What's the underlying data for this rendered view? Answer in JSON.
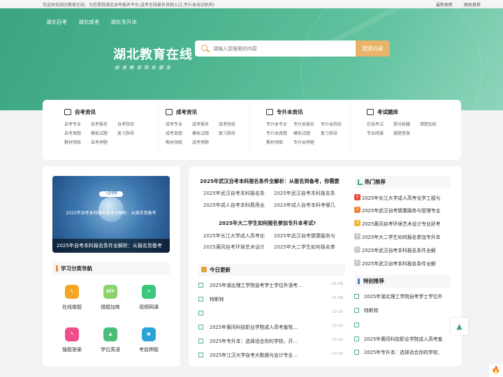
{
  "topbar": {
    "welcome": "欢迎来到湖北教育在线，为您提供湖北自考报名平台,成考在线报名官网入口,专升本培训机构!",
    "links": [
      "最新更新",
      "随机推荐"
    ]
  },
  "nav": [
    "湖北自考",
    "湖北成考",
    "湖北专升本"
  ],
  "brand": {
    "title": "湖北教育在线",
    "subtitle": "继续教育院校服务"
  },
  "search": {
    "placeholder": "请输入您搜索的内容",
    "button": "搜索内容"
  },
  "categories": [
    {
      "title": "自考资讯",
      "links": [
        "自考专业",
        "自考报名",
        "自考院校",
        "自考真题",
        "模拟试题",
        "复习指导",
        "教材领取",
        "自考押题"
      ]
    },
    {
      "title": "成考资讯",
      "links": [
        "成考专业",
        "成考报名",
        "成考院校",
        "成考真题",
        "模拟试题",
        "复习指导",
        "教材领取",
        "成考押题"
      ]
    },
    {
      "title": "专升本资讯",
      "links": [
        "专升本专业",
        "专升本报名",
        "专升本院校",
        "专升本真题",
        "模拟试题",
        "复习指导",
        "教材领取",
        "专升本押题"
      ]
    },
    {
      "title": "考试题库",
      "links": [
        "在线考试",
        "提分秘籍",
        "错题加练",
        "专业网课",
        "搜题答案"
      ]
    }
  ],
  "banner": {
    "overlay": "2025年自考本科报名条件全解析：从报名到备考",
    "pill": "+自考网",
    "caption": "2025年自考本科报名条件全解析：从报名到备考"
  },
  "study_nav": {
    "title": "学习分类导航",
    "tools": [
      {
        "label": "在线做题",
        "icon": "pencil-icon",
        "glyph": "✎",
        "color": "#f5a623"
      },
      {
        "label": "错题加练",
        "icon": "diy-icon",
        "glyph": "DIY",
        "color": "#8bd36a"
      },
      {
        "label": "视频网课",
        "icon": "video-icon",
        "glyph": "☀",
        "color": "#3cc77e"
      },
      {
        "label": "搜题答案",
        "icon": "search-answer-icon",
        "glyph": "✎",
        "color": "#ee4d8b"
      },
      {
        "label": "学位英语",
        "icon": "cap-icon",
        "glyph": "▲",
        "color": "#4bbf7a"
      },
      {
        "label": "考前押题",
        "icon": "briefcase-icon",
        "glyph": "▣",
        "color": "#2ba3d8"
      }
    ]
  },
  "middle": {
    "headline1": "2025年武汉自考本科报名条件全解析：从报名到备考，你需要",
    "links1": [
      "2025年武汉自考本科报名条",
      "2025年武汉自考本科报名条",
      "2025年成人自考本科费用全",
      "2023年成人自考本科考哪几"
    ],
    "headline2": "2025年大二学生如何报名参加专升本考试?",
    "links2": [
      "2025年长江大学成人高考化",
      "2025年武汉自考健康服务与",
      "2025黄冈自考环境艺术设计",
      "2025年大二学生如何报名参"
    ],
    "today_title": "今日更新",
    "news": [
      {
        "title": "2025年湖北理工学院自考学士学位外语考...",
        "date": "01-08"
      },
      {
        "title": "特斯特",
        "date": "01-08"
      },
      {
        "title": "",
        "date": "12-16"
      },
      {
        "title": "2025年黄冈科技职业学院成人高考畜牧...",
        "date": "12-16"
      },
      {
        "title": "2025年专升本：选择适合你的学校，开...",
        "date": "12-16"
      },
      {
        "title": "2025年江汉大学自考大数据与会计专业...",
        "date": "12-16"
      }
    ]
  },
  "hot": {
    "title": "热门推荐",
    "items": [
      {
        "num": "1",
        "color": "#e84c3d",
        "title": "2025年长江大学成人高考化学工程与"
      },
      {
        "num": "2",
        "color": "#f0813a",
        "title": "2025年武汉自考健康服务与管理专业"
      },
      {
        "num": "3",
        "color": "#f3b53b",
        "title": "2025黄冈自考环境艺术设计专业好考"
      },
      {
        "num": "4",
        "color": "#c8c8c8",
        "title": "2025年大二学生如何报名参加专升本"
      },
      {
        "num": "5",
        "color": "#c8c8c8",
        "title": "2025年武汉自考本科报名条件全解"
      },
      {
        "num": "6",
        "color": "#c8c8c8",
        "title": "2025年武汉自考本科报名条件全解"
      }
    ]
  },
  "recommend": {
    "title": "特别推荐",
    "items": [
      "2025年湖北理工学院自考学士学位外",
      "特斯特",
      "",
      "2025年黄冈科技职业学院成人高考畜",
      "2025年专升本：选择适合你的学校,"
    ]
  },
  "colors": {
    "brand_green": "#3fa87e",
    "search_button": "#e9b46a"
  },
  "floating": {
    "totop": "▲",
    "fire": "🔥"
  }
}
